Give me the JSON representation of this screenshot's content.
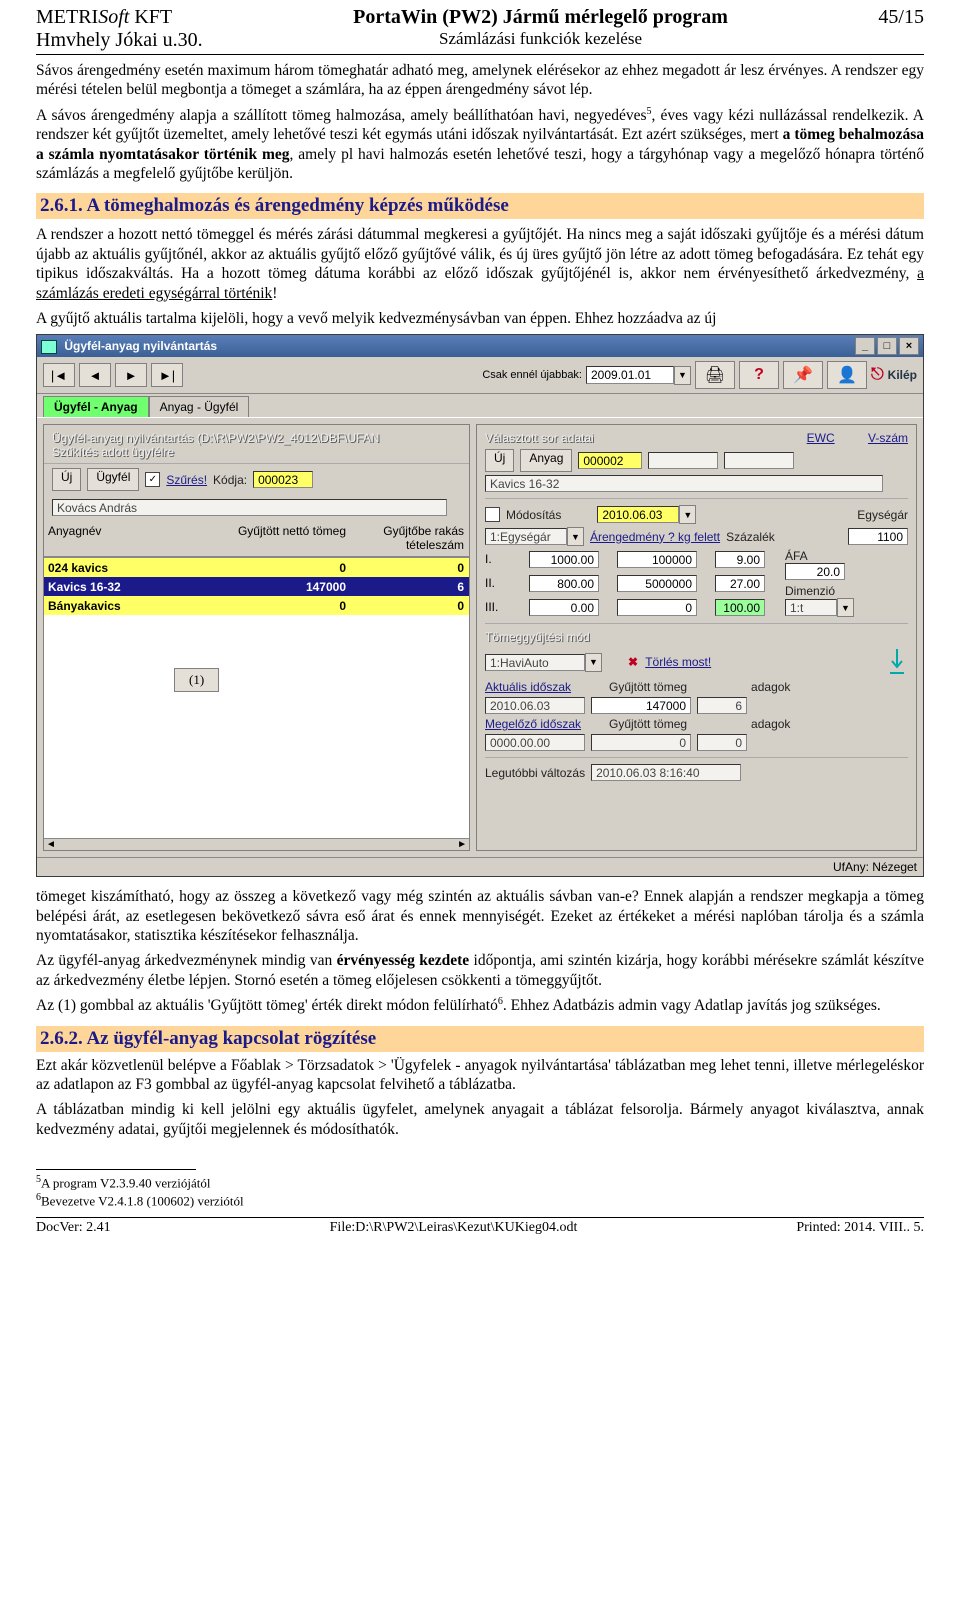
{
  "header": {
    "company": "METRISoft KFT",
    "company_pre": "METRI",
    "company_it": "Soft",
    "company_post": " KFT",
    "address": "Hmvhely Jókai u.30.",
    "title": "PortaWin (PW2) Jármű mérlegelő program",
    "subtitle": "Számlázási funkciók kezelése",
    "page": "45/15"
  },
  "para1": "Sávos árengedmény esetén maximum három tömeghatár adható meg, amelynek elérésekor az ehhez megadott ár lesz érvényes. A rendszer egy mérési tételen belül megbontja a tömeget a számlára, ha az éppen árengedmény sávot lép.",
  "para2a": "A sávos árengedmény alapja a szállított tömeg halmozása, amely beállíthatóan havi, negyedéves",
  "para2b": ", éves vagy kézi nullázással rendelkezik. A rendszer két gyűjtőt üzemeltet, amely lehetővé teszi két egymás utáni időszak nyilvántartását. Ezt azért szükséges, mert ",
  "para2c": "a tömeg behalmozása a számla nyomtatásakor történik meg",
  "para2d": ", amely pl havi halmozás esetén lehetővé teszi, hogy a tárgyhónap vagy a megelőző hónapra történő számlázás a megfelelő gyűjtőbe kerüljön.",
  "h261": "2.6.1.  A tömeghalmozás és árengedmény képzés működése",
  "para3": "A rendszer a hozott nettó tömeggel és mérés zárási dátummal megkeresi a gyűjtőjét. Ha nincs meg a saját időszaki gyűjtője és a mérési dátum újabb az aktuális gyűjtőnél, akkor az aktuális gyűjtő előző gyűjtővé válik, és új üres gyűjtő jön létre az adott tömeg befogadására. Ez tehát egy tipikus időszakváltás. Ha a hozott tömeg dátuma korábbi az előző időszak gyűjtőjénél is, akkor nem érvényesíthető árkedvezmény, ",
  "para3u": "a számlázás eredeti egységárral történik",
  "para3end": "!",
  "para4": "A gyűjtő aktuális tartalma kijelöli, hogy a vevő melyik kedvezménysávban van éppen. Ehhez hozzáadva az új",
  "para5": "tömeget kiszámítható, hogy az összeg a következő vagy még szintén az aktuális sávban van-e? Ennek alapján a rendszer megkapja a tömeg belépési árát, az esetlegesen bekövetkező sávra eső árat és ennek mennyiségét. Ezeket az értékeket a mérési naplóban tárolja és a számla nyomtatásakor, statisztika készítésekor felhasználja.",
  "para6a": "Az ügyfél-anyag árkedvezménynek mindig van ",
  "para6b": "érvényesség kezdete",
  "para6c": " időpontja, ami szintén kizárja, hogy korábbi mérésekre számlát készítve az árkedvezmény életbe lépjen. Stornó esetén a tömeg előjelesen csökkenti a tömeggyűjtőt.",
  "para7a": "Az (1) gombbal az aktuális 'Gyűjtött tömeg' érték direkt módon felülírható",
  "para7b": ". Ehhez Adatbázis admin vagy Adatlap javítás jog szükséges.",
  "h262": "2.6.2.  Az ügyfél-anyag kapcsolat rögzítése",
  "para8": "Ezt akár közvetlenül belépve a Főablak > Törzsadatok > 'Ügyfelek - anyagok nyilvántartása' táblázatban meg lehet tenni, illetve mérlegeléskor az adatlapon az F3 gombbal az ügyfél-anyag kapcsolat felvihető a táblázatba.",
  "para9": "A táblázatban mindig ki kell jelölni egy aktuális ügyfelet, amelynek anyagait a táblázat felsorolja. Bármely anyagot kiválasztva, annak kedvezmény adatai, gyűjtői megjelennek és módosíthatók.",
  "fn5": "A program V2.3.9.40 verziójától",
  "fn6": "Bevezetve V2.4.1.8 (100602) verziótól",
  "footer": {
    "docver": "DocVer: 2.41",
    "file": "File:D:\\R\\PW2\\Leiras\\Kezut\\KUKieg04.odt",
    "printed": "Printed: 2014. VIII.. 5."
  },
  "app": {
    "title": "Ügyfél-anyag nyilvántartás",
    "toolbar": {
      "first": "|◄",
      "prev": "◄",
      "next": "►",
      "last": "►|",
      "csak_label": "Csak ennél újabbak:",
      "date": "2009.01.01",
      "print_icon": "🖨",
      "help_icon": "?",
      "pin_icon": "📌",
      "user_icon": "👤",
      "kilep": "Kilép",
      "kilep_icon": "⎋"
    },
    "tabs": {
      "t1": "Ügyfél - Anyag",
      "t2": "Anyag - Ügyfél"
    },
    "left": {
      "path_label": "Ügyfél-anyag nyilvántartás (D:\\R\\PW2\\PW2_4012\\DBF\\UFAN",
      "szuk_label": "Szűkítés adott ügyfélre",
      "uj": "Új",
      "ugyfel": "Ügyfél",
      "szures_chk": "✓",
      "szures": "Szűrés!",
      "kodja": "Kódja:",
      "kod": "000023",
      "name": "Kovács András",
      "col1": "Anyagnév",
      "col2": "Gyűjtött nettó tömeg",
      "col3": "Gyűjtőbe rakás tételeszám",
      "rows": [
        {
          "n": "024 kavics",
          "t": "0",
          "c": "0"
        },
        {
          "n": "Kavics 16-32",
          "t": "147000",
          "c": "6"
        },
        {
          "n": "Bányakavics",
          "t": "0",
          "c": "0"
        }
      ],
      "overlay": "(1)"
    },
    "right": {
      "title": "Választott sor adatai",
      "ewc": "EWC",
      "vszam": "V-szám",
      "uj": "Új",
      "anyag": "Anyag",
      "anyag_code": "000002",
      "anyag_name": "Kavics 16-32",
      "modositas": "Módosítás",
      "erv_date": "2010.06.03",
      "egysegar": "Egységár",
      "combo": "1:Egységár",
      "are_lbl": "Árengedmény ? kg felett",
      "szazalek": "Százalék",
      "ar_val": "1100",
      "afa": "ÁFA",
      "afa_val": "20.0",
      "dimenzio": "Dimenzió",
      "dim_val": "1:t",
      "rows": [
        {
          "l": "I.",
          "a": "1000.00",
          "b": "100000",
          "c": "9.00"
        },
        {
          "l": "II.",
          "a": "800.00",
          "b": "5000000",
          "c": "27.00"
        },
        {
          "l": "III.",
          "a": "0.00",
          "b": "0",
          "c": "100.00"
        }
      ],
      "tgy_label": "Tömeggyűjtési mód",
      "tgy_combo": "1:HaviAuto",
      "torles": "Törlés most!",
      "akt_label": "Aktuális időszak",
      "gyt_label": "Gyűjtött tömeg",
      "adag_label": "adagok",
      "akt_date": "2010.06.03",
      "akt_gyt": "147000",
      "akt_adag": "6",
      "meg_label": "Megelőző időszak",
      "meg_date": "0000.00.00",
      "meg_gyt": "0",
      "meg_adag": "0",
      "leg_label": "Legutóbbi változás",
      "leg_val": "2010.06.03 8:16:40"
    },
    "status": "UfAny: Nézeget"
  }
}
